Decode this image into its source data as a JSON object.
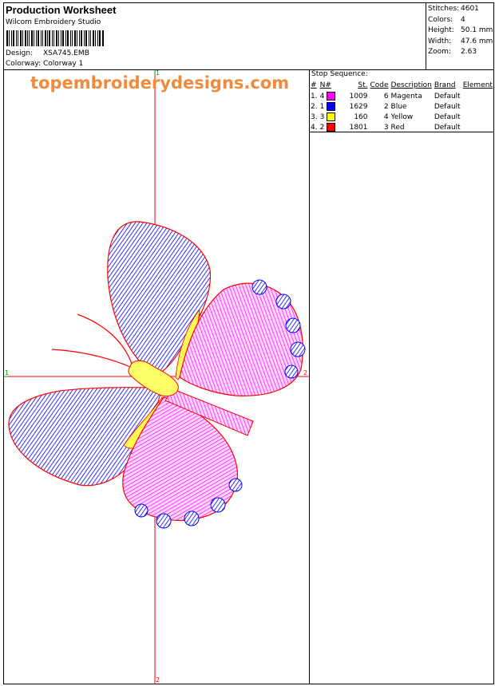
{
  "header": {
    "title": "Production Worksheet",
    "software": "Wilcom Embroidery Studio",
    "design_label": "Design:",
    "design_value": "XSA745.EMB",
    "colorway_label": "Colorway:",
    "colorway_value": "Colorway 1"
  },
  "stats": [
    {
      "label": "Stitches:",
      "value": "4601"
    },
    {
      "label": "Colors:",
      "value": "4"
    },
    {
      "label": "Height:",
      "value": "50.1 mm"
    },
    {
      "label": "Width:",
      "value": "47.6 mm"
    },
    {
      "label": "Zoom:",
      "value": "2.63"
    }
  ],
  "watermark": "topembroiderydesigns.com",
  "stop_sequence": {
    "title": "Stop Sequence:",
    "columns": [
      "#",
      "N#",
      "St.",
      "Code",
      "Description",
      "Brand",
      "Element"
    ],
    "rows": [
      {
        "idx": "1.",
        "n": "4",
        "color": "#ff00ff",
        "st": "1009",
        "code": "6",
        "desc": "Magenta",
        "brand": "Default",
        "element": ""
      },
      {
        "idx": "2.",
        "n": "1",
        "color": "#0000ff",
        "st": "1629",
        "code": "2",
        "desc": "Blue",
        "brand": "Default",
        "element": ""
      },
      {
        "idx": "3.",
        "n": "3",
        "color": "#ffff00",
        "st": "160",
        "code": "4",
        "desc": "Yellow",
        "brand": "Default",
        "element": ""
      },
      {
        "idx": "4.",
        "n": "2",
        "color": "#ff0000",
        "st": "1801",
        "code": "3",
        "desc": "Red",
        "brand": "Default",
        "element": ""
      }
    ]
  },
  "axis_labels": {
    "top": "1",
    "left": "1",
    "right": "2",
    "bottom": "2"
  },
  "colors": {
    "magenta": "#ff00ff",
    "blue": "#0000ff",
    "yellow": "#ffff00",
    "red": "#ff0000",
    "watermark": "#f08a3c"
  }
}
